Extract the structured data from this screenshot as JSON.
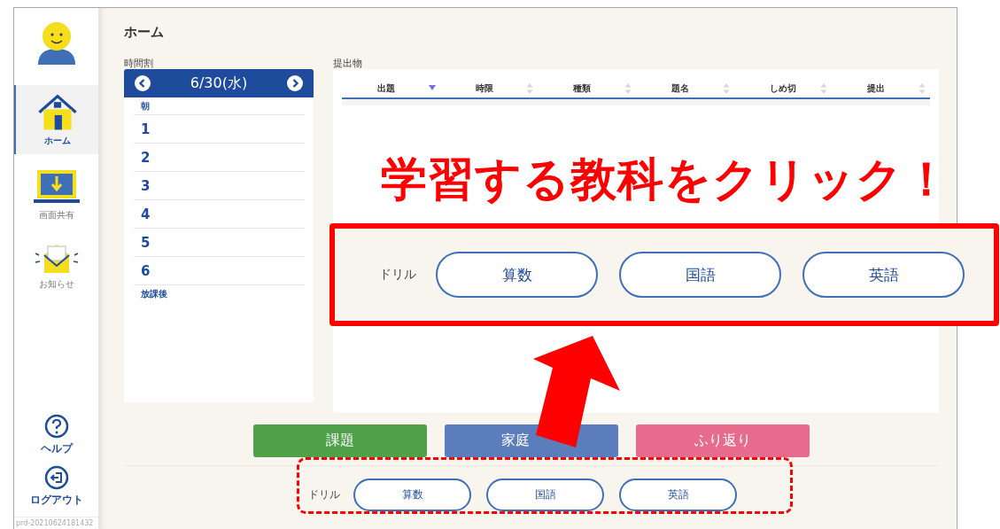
{
  "sidebar": {
    "items": [
      {
        "label": "ホーム",
        "selected": true
      },
      {
        "label": "画面共有",
        "selected": false
      },
      {
        "label": "お知らせ",
        "selected": false
      }
    ],
    "bottom_items": [
      {
        "label": "ヘルプ"
      },
      {
        "label": "ログアウト"
      }
    ],
    "version": "prd-20210624181432"
  },
  "page_title": "ホーム",
  "timetable": {
    "label": "時間割",
    "date": "6/30(水)",
    "periods": [
      {
        "label": "朝",
        "kind": "small"
      },
      {
        "label": "1",
        "kind": "number"
      },
      {
        "label": "2",
        "kind": "number"
      },
      {
        "label": "3",
        "kind": "number"
      },
      {
        "label": "4",
        "kind": "number"
      },
      {
        "label": "5",
        "kind": "number"
      },
      {
        "label": "6",
        "kind": "number"
      },
      {
        "label": "放課後",
        "kind": "small"
      }
    ]
  },
  "submissions": {
    "label": "提出物",
    "columns": [
      {
        "label": "出題",
        "sorted": true
      },
      {
        "label": "時限",
        "sorted": false
      },
      {
        "label": "種類",
        "sorted": false
      },
      {
        "label": "題名",
        "sorted": false
      },
      {
        "label": "しめ切",
        "sorted": false
      },
      {
        "label": "提出",
        "sorted": false
      }
    ]
  },
  "action_buttons": [
    {
      "label": "課題",
      "color": "#4fa24a"
    },
    {
      "label": "家庭",
      "color": "#5b7dbb"
    },
    {
      "label": "ふり返り",
      "color": "#e76b8d"
    }
  ],
  "drill": {
    "label": "ドリル",
    "subjects": [
      "算数",
      "国語",
      "英語"
    ]
  },
  "annotation": {
    "callout": "学習する教科をクリック！",
    "zoomed_drill": {
      "label": "ドリル",
      "subjects": [
        "算数",
        "国語",
        "英語"
      ]
    }
  }
}
